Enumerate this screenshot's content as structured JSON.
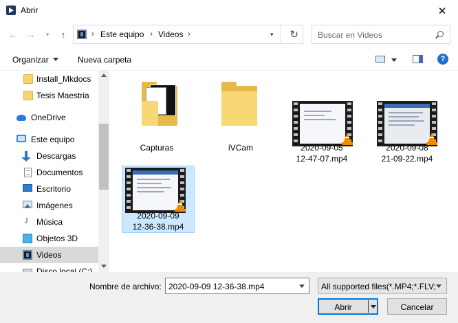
{
  "window": {
    "title": "Abrir"
  },
  "nav": {
    "breadcrumbs": [
      "Este equipo",
      "Videos"
    ],
    "search_placeholder": "Buscar en Videos"
  },
  "toolbar": {
    "organize": "Organizar",
    "new_folder": "Nueva carpeta"
  },
  "sidebar": {
    "items": [
      {
        "label": "Install_Mkdocs",
        "icon": "folder-icon"
      },
      {
        "label": "Tesis Maestria",
        "icon": "folder-icon"
      },
      {
        "label": "OneDrive",
        "icon": "cloud-icon"
      },
      {
        "label": "Este equipo",
        "icon": "computer-icon"
      },
      {
        "label": "Descargas",
        "icon": "download-icon"
      },
      {
        "label": "Documentos",
        "icon": "document-icon"
      },
      {
        "label": "Escritorio",
        "icon": "desktop-icon"
      },
      {
        "label": "Imágenes",
        "icon": "pictures-icon"
      },
      {
        "label": "Música",
        "icon": "music-icon"
      },
      {
        "label": "Objetos 3D",
        "icon": "3d-objects-icon"
      },
      {
        "label": "Videos",
        "icon": "videos-icon",
        "selected": true
      },
      {
        "label": "Disco local (C:)",
        "icon": "drive-icon"
      }
    ]
  },
  "files": [
    {
      "name": "Capturas",
      "type": "folder"
    },
    {
      "name": "iVCam",
      "type": "folder"
    },
    {
      "name_line1": "2020-09-05",
      "name_line2": "12-47-07.mp4",
      "type": "video"
    },
    {
      "name_line1": "2020-09-08",
      "name_line2": "21-09-22.mp4",
      "type": "video"
    },
    {
      "name_line1": "2020-09-09",
      "name_line2": "12-36-38.mp4",
      "type": "video",
      "selected": true
    }
  ],
  "footer": {
    "filename_label": "Nombre de archivo:",
    "filename_value": "2020-09-09 12-36-38.mp4",
    "filter_value": "All supported files(*.MP4;*.FLV;",
    "open_label": "Abrir",
    "cancel_label": "Cancelar"
  }
}
